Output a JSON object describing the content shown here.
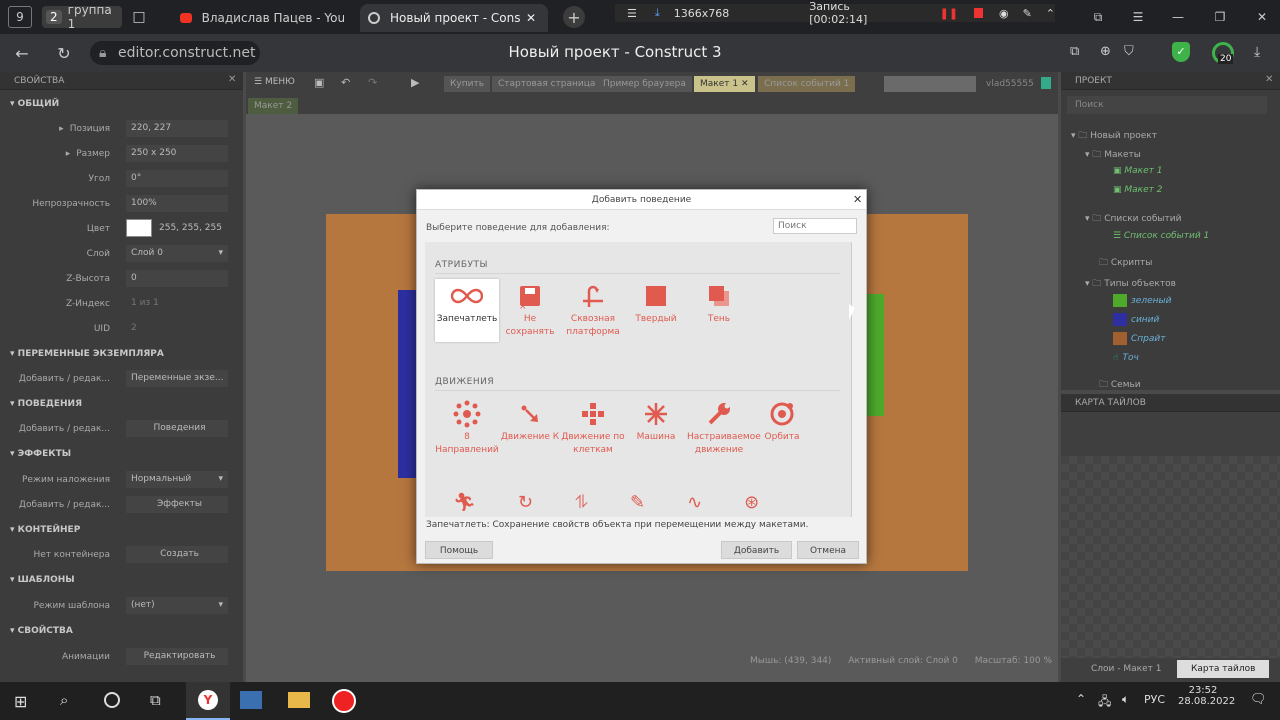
{
  "browser": {
    "tab_group_count": "2",
    "tab_group_label": "группа 1",
    "tabs": [
      {
        "label": "Владислав Пацев - YouTube"
      },
      {
        "label": "Новый проект - Construct 3"
      }
    ],
    "workspace_number": "9",
    "resolution": "1366x768",
    "recording": "Запись [00:02:14]",
    "url": "editor.construct.net",
    "page_title": "Новый проект - Construct 3",
    "badge_count": "20"
  },
  "editor": {
    "toolbar": {
      "menu": "МЕНЮ",
      "tabs": [
        "Купить",
        "Стартовая страница",
        "Пример браузера",
        "Макет 1",
        "Список событий 1"
      ],
      "row2_tab": "Макет 2",
      "user": "vlad55555"
    },
    "properties": {
      "header": "СВОЙСТВА",
      "general": "ОБЩИЙ",
      "rows": [
        {
          "label": "Позиция",
          "value": "220, 227"
        },
        {
          "label": "Размер",
          "value": "250 x 250"
        },
        {
          "label": "Угол",
          "value": "0°"
        },
        {
          "label": "Непрозрачность",
          "value": "100%"
        },
        {
          "label": "Цвет",
          "value": "255, 255, 255"
        },
        {
          "label": "Слой",
          "value": "Слой 0"
        },
        {
          "label": "Z-Высота",
          "value": "0"
        },
        {
          "label": "Z-Индекс",
          "value": "1 из 1"
        },
        {
          "label": "UID",
          "value": "2"
        }
      ],
      "sections": [
        {
          "title": "ПЕРЕМЕННЫЕ ЭКЗЕМПЛЯРА",
          "label": "Добавить / редак...",
          "value": "Переменные экзе..."
        },
        {
          "title": "ПОВЕДЕНИЯ",
          "label": "Добавить / редак...",
          "value": "Поведения"
        },
        {
          "title": "ЭФФЕКТЫ",
          "label": "Режим наложения",
          "value": "Нормальный",
          "label2": "Добавить / редак...",
          "value2": "Эффекты"
        },
        {
          "title": "КОНТЕЙНЕР",
          "label": "Нет контейнера",
          "value": "Создать"
        },
        {
          "title": "ШАБЛОНЫ",
          "label": "Режим шаблона",
          "value": "(нет)"
        },
        {
          "title": "СВОЙСТВА",
          "label": "Анимации",
          "value": "Редактировать"
        }
      ]
    },
    "project": {
      "header": "ПРОЕКТ",
      "search": "Поиск",
      "tree": [
        {
          "label": "Новый проект"
        },
        {
          "label": "Макеты"
        },
        {
          "label": "Макет 1"
        },
        {
          "label": "Макет 2"
        },
        {
          "label": "Списки событий"
        },
        {
          "label": "Список событий 1"
        },
        {
          "label": "Скрипты"
        },
        {
          "label": "Типы объектов"
        },
        {
          "label": "зеленый"
        },
        {
          "label": "синий"
        },
        {
          "label": "Спрайт"
        },
        {
          "label": "Точ"
        },
        {
          "label": "Семьи"
        }
      ]
    },
    "tilemap": {
      "header": "КАРТА ТАЙЛОВ",
      "tabs": [
        "Слои - Макет 1",
        "Карта тайлов"
      ]
    },
    "statusbar": {
      "mouse": "Мышь: (439, 344)",
      "layer": "Активный слой: Слой 0",
      "zoom": "Масштаб: 100 %"
    }
  },
  "dialog": {
    "title": "Добавить поведение",
    "prompt": "Выберите поведение для добавления:",
    "search_placeholder": "Поиск",
    "groups": [
      {
        "title": "АТРИБУТЫ",
        "items": [
          {
            "label": "Запечатлеть",
            "icon": "infinity-icon"
          },
          {
            "label": "Не сохранять",
            "icon": "no-save-icon"
          },
          {
            "label": "Сквозная платформа",
            "icon": "jump-thru-icon"
          },
          {
            "label": "Твердый",
            "icon": "solid-icon"
          },
          {
            "label": "Тень",
            "icon": "shadow-icon"
          }
        ]
      },
      {
        "title": "ДВИЖЕНИЯ",
        "items": [
          {
            "label": "8 Направлений",
            "icon": "eight-direction-icon"
          },
          {
            "label": "Движение К",
            "icon": "move-to-icon"
          },
          {
            "label": "Движение по клеткам",
            "icon": "tile-movement-icon"
          },
          {
            "label": "Машина",
            "icon": "car-icon"
          },
          {
            "label": "Настраиваемое движение",
            "icon": "wrench-icon"
          },
          {
            "label": "Орбита",
            "icon": "orbit-icon"
          }
        ]
      }
    ],
    "description": "Запечатлеть: Сохранение свойств объекта при перемещении между макетами.",
    "help": "Помощь",
    "add": "Добавить",
    "cancel": "Отмена"
  },
  "taskbar": {
    "lang": "РУС",
    "time": "23:52",
    "date": "28.08.2022"
  },
  "colors": {
    "accent": "#e05a4f",
    "green": "#5fbf3a",
    "blue": "#3b3fb8",
    "brown": "#c07a3c"
  }
}
